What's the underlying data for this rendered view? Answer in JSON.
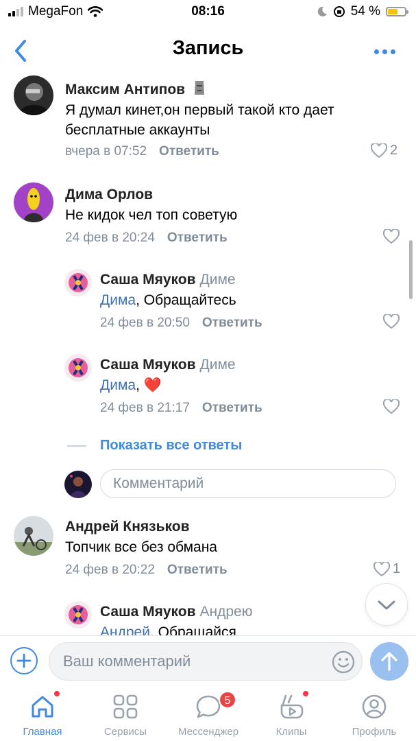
{
  "status_bar": {
    "carrier": "MegaFon",
    "time": "08:16",
    "battery": "54 %",
    "battery_level": 0.54
  },
  "nav": {
    "title": "Запись"
  },
  "comments": [
    {
      "author": "Максим Антипов",
      "text": "Я думал кинет,он первый такой кто дает бесплатные аккаунты",
      "date": "вчера в 07:52",
      "reply": "Ответить",
      "likes": "2"
    },
    {
      "author": "Дима Орлов",
      "text": "Не кидок чел топ советую",
      "date": "24 фев в 20:24",
      "reply": "Ответить",
      "likes": ""
    },
    {
      "author": "Саша Мяуков",
      "to": "Диме",
      "mention": "Дима",
      "text": ", Обращайтесь",
      "date": "24 фев в 20:50",
      "reply": "Ответить",
      "likes": ""
    },
    {
      "author": "Саша Мяуков",
      "to": "Диме",
      "mention": "Дима",
      "text": ", ",
      "emoji": "❤️",
      "date": "24 фев в 21:17",
      "reply": "Ответить",
      "likes": ""
    },
    {
      "author": "Андрей Князьков",
      "text": "Топчик все без обмана",
      "date": "24 фев в 20:22",
      "reply": "Ответить",
      "likes": "1"
    },
    {
      "author": "Саша Мяуков",
      "to": "Андрею",
      "mention": "Андрей",
      "text": ", Обращайся"
    }
  ],
  "show_all_replies": "Показать все ответы",
  "reply_input": {
    "placeholder": "Комментарий"
  },
  "composer": {
    "placeholder": "Ваш комментарий"
  },
  "tabs": [
    {
      "label": "Главная",
      "icon": "home-icon",
      "active": true,
      "dot": true
    },
    {
      "label": "Сервисы",
      "icon": "services-icon"
    },
    {
      "label": "Мессенджер",
      "icon": "messenger-icon",
      "badge": "5"
    },
    {
      "label": "Клипы",
      "icon": "clips-icon",
      "dot": true
    },
    {
      "label": "Профиль",
      "icon": "profile-icon"
    }
  ],
  "colors": {
    "accent": "#3f8ae0",
    "secondary_text": "#818c99",
    "badge": "#e64646",
    "link": "#3f6fb0"
  }
}
